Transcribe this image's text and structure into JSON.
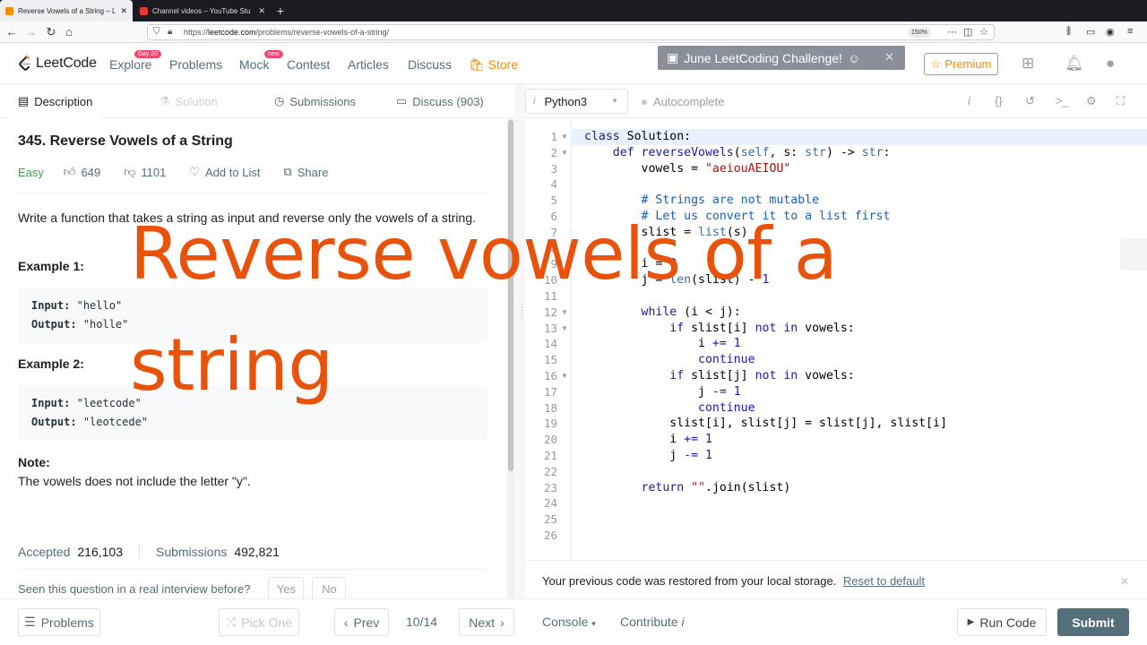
{
  "browser": {
    "tabs": [
      {
        "title": "Reverse Vowels of a String – Le",
        "active": true
      },
      {
        "title": "Channel videos – YouTube Stu",
        "active": false
      }
    ],
    "url_prefix": "https://",
    "url_domain": "leetcode.com",
    "url_path": "/problems/reverse-vowels-of-a-string/",
    "zoom": "150%"
  },
  "header": {
    "logo": "LeetCode",
    "nav": [
      {
        "label": "Explore",
        "badge": "Day 20"
      },
      {
        "label": "Problems"
      },
      {
        "label": "Mock",
        "badge": "new"
      },
      {
        "label": "Contest"
      },
      {
        "label": "Articles"
      },
      {
        "label": "Discuss"
      },
      {
        "label": "Store"
      }
    ],
    "banner": "June LeetCoding Challenge!",
    "premium": "Premium"
  },
  "left_tabs": [
    "Description",
    "Solution",
    "Submissions",
    "Discuss (903)"
  ],
  "problem": {
    "title": "345. Reverse Vowels of a String",
    "difficulty": "Easy",
    "likes": "649",
    "dislikes": "1101",
    "add_to_list": "Add to List",
    "share": "Share",
    "description": "Write a function that takes a string as input and reverse only the vowels of a string.",
    "examples": [
      {
        "title": "Example 1:",
        "input_label": "Input:",
        "input": "\"hello\"",
        "output_label": "Output:",
        "output": "\"holle\""
      },
      {
        "title": "Example 2:",
        "input_label": "Input:",
        "input": "\"leetcode\"",
        "output_label": "Output:",
        "output": "\"leotcede\""
      }
    ],
    "note_title": "Note:",
    "note": "The vowels does not include the letter \"y\".",
    "accepted_label": "Accepted",
    "accepted": "216,103",
    "submissions_label": "Submissions",
    "submissions": "492,821",
    "interview_q": "Seen this question in a real interview before?",
    "yes": "Yes",
    "no": "No"
  },
  "editor": {
    "language": "Python3",
    "autocomplete": "Autocomplete",
    "restore_msg": "Your previous code was restored from your local storage.",
    "reset_link": "Reset to default"
  },
  "bottom": {
    "problems": "Problems",
    "pick_one": "Pick One",
    "prev": "Prev",
    "page": "10/14",
    "next": "Next",
    "console": "Console",
    "contribute": "Contribute",
    "run_code": "Run Code",
    "submit": "Submit"
  },
  "overlay": {
    "line1": "Reverse vowels of a",
    "line2": "string"
  }
}
